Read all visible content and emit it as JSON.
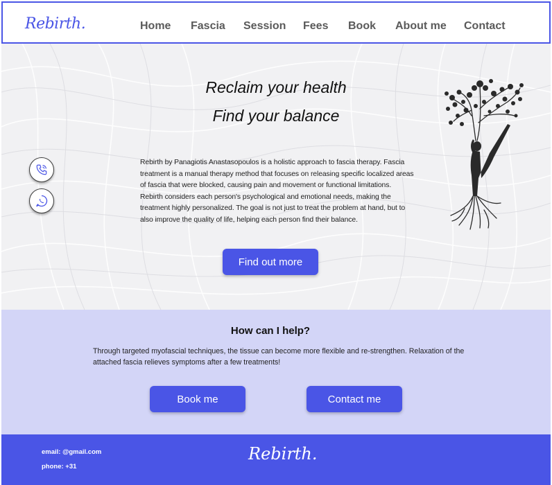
{
  "brand": {
    "logo_text": "Rebirth.",
    "accent_color": "#4a55e6",
    "light_accent_color": "#d3d5f7"
  },
  "nav": {
    "items": [
      {
        "label": "Home"
      },
      {
        "label": "Fascia"
      },
      {
        "label": "Session"
      },
      {
        "label": "Fees"
      },
      {
        "label": "Book"
      },
      {
        "label": "About me"
      },
      {
        "label": "Contact"
      }
    ]
  },
  "hero": {
    "title_line1": "Reclaim your health",
    "title_line2": "Find your balance",
    "body": "Rebirth by Panagiotis Anastasopoulos is a holistic approach to fascia therapy. Fascia treatment is a manual therapy method that focuses on releasing specific localized areas of fascia that were blocked, causing  pain and movement or functional limitations. Rebirth considers each person's psychological and emotional  needs, making the treatment highly personalized. The goal is not just to treat the problem at hand, but  to also improve the quality of life, helping each person find their balance.",
    "cta_label": "Find out more",
    "floating_icons": [
      "phone-icon",
      "whatsapp-icon"
    ],
    "illustration": "tree-figure-illustration"
  },
  "help": {
    "title": "How can I help?",
    "body": "Through targeted myofascial techniques, the tissue can become more flexible and re-strengthen. Relaxation of the attached fascia relieves symptoms after a few treatments!",
    "book_label": "Book me",
    "contact_label": "Contact me"
  },
  "footer": {
    "email": "email: @gmail.com",
    "phone": "phone: +31",
    "logo_text": "Rebirth."
  }
}
